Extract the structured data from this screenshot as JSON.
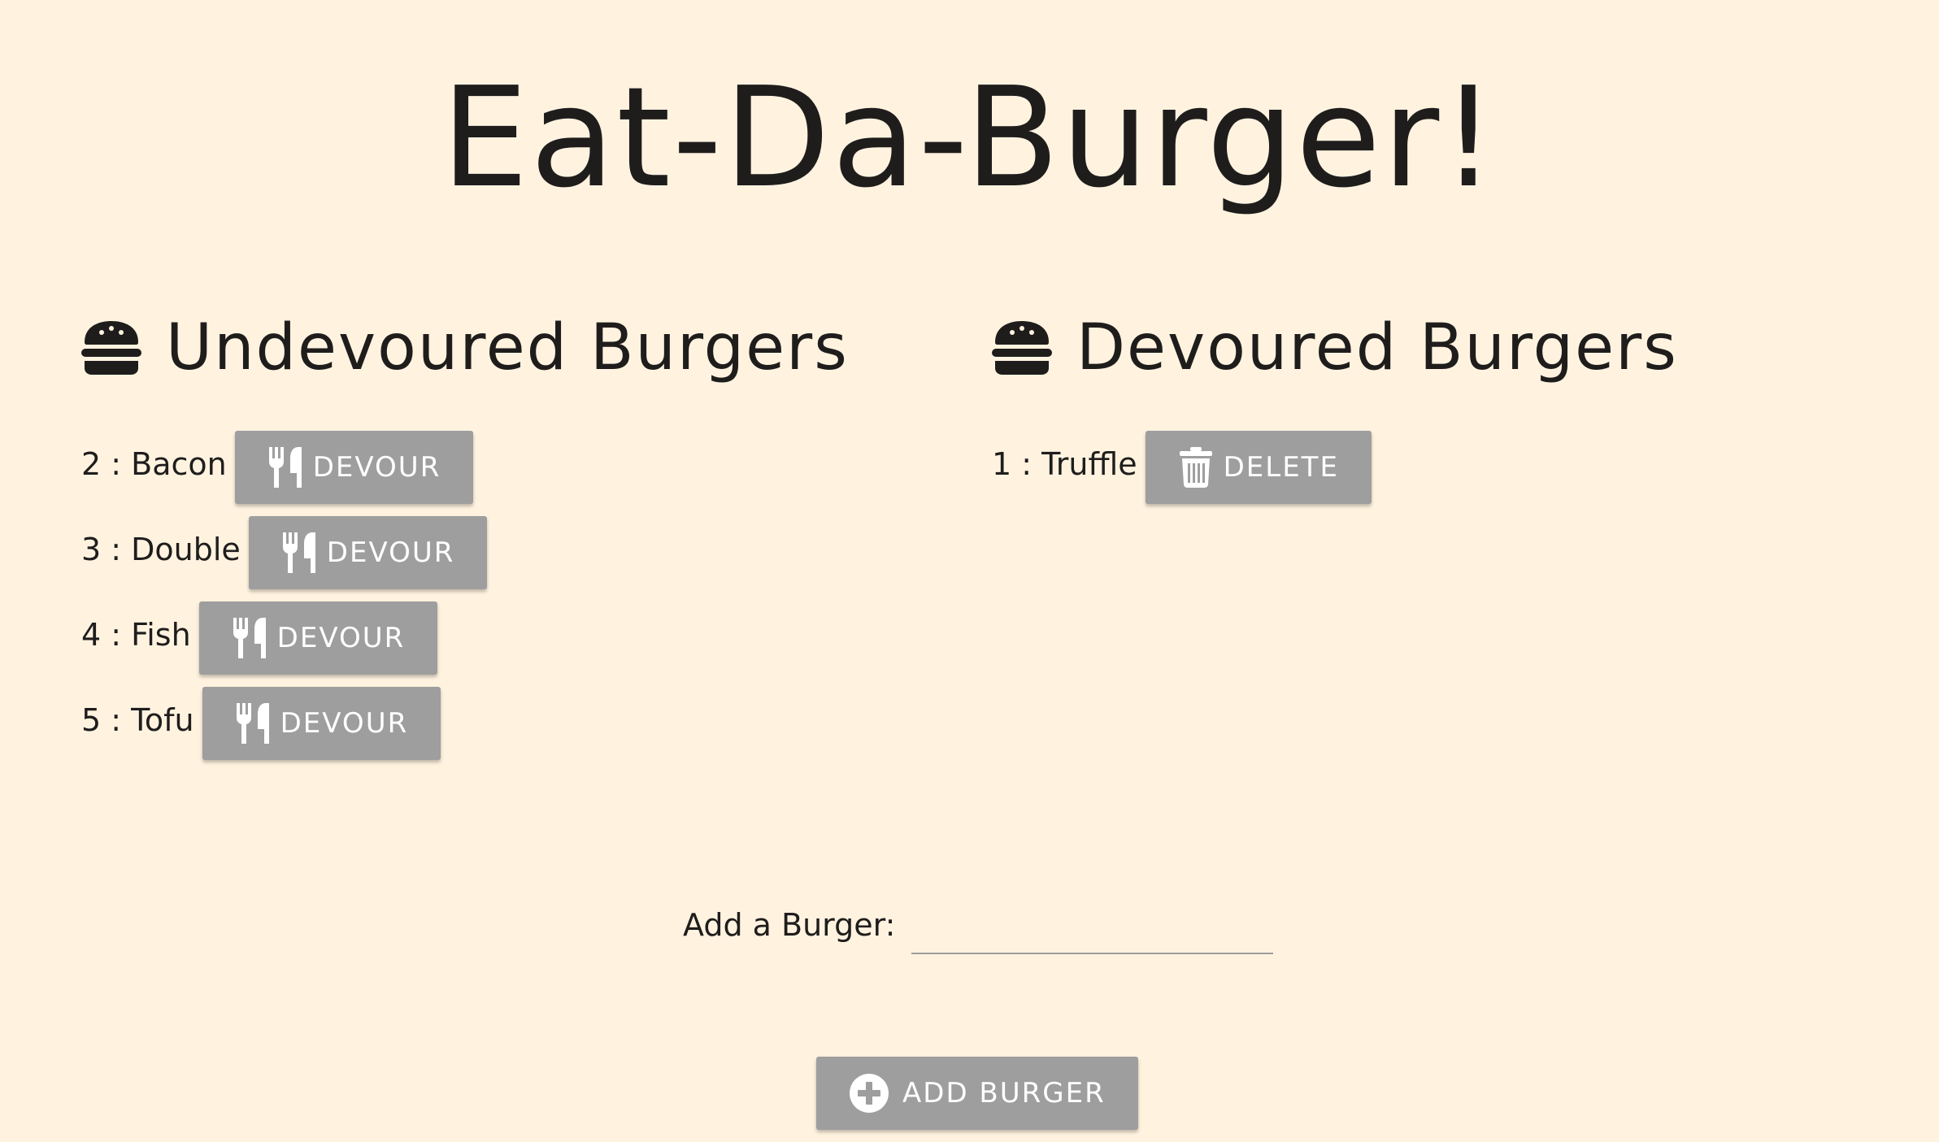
{
  "header": {
    "title": "Eat-Da-Burger!"
  },
  "undevoured": {
    "heading": "Undevoured Burgers",
    "icon": "hamburger-icon",
    "items": [
      {
        "label": "2 : Bacon",
        "button_label": "DEVOUR",
        "button_icon": "utensils-icon"
      },
      {
        "label": "3 : Double",
        "button_label": "DEVOUR",
        "button_icon": "utensils-icon"
      },
      {
        "label": "4 : Fish",
        "button_label": "DEVOUR",
        "button_icon": "utensils-icon"
      },
      {
        "label": "5 : Tofu",
        "button_label": "DEVOUR",
        "button_icon": "utensils-icon"
      }
    ]
  },
  "devoured": {
    "heading": "Devoured Burgers",
    "icon": "hamburger-icon",
    "items": [
      {
        "label": "1 : Truffle",
        "button_label": "DELETE",
        "button_icon": "trash-icon"
      }
    ]
  },
  "form": {
    "label": "Add a Burger:",
    "input_value": "",
    "submit_label": "ADD BURGER",
    "submit_icon": "plus-circle-icon"
  },
  "colors": {
    "background": "#fff3e0",
    "button": "#9e9e9e",
    "text": "#1f1d1c"
  }
}
